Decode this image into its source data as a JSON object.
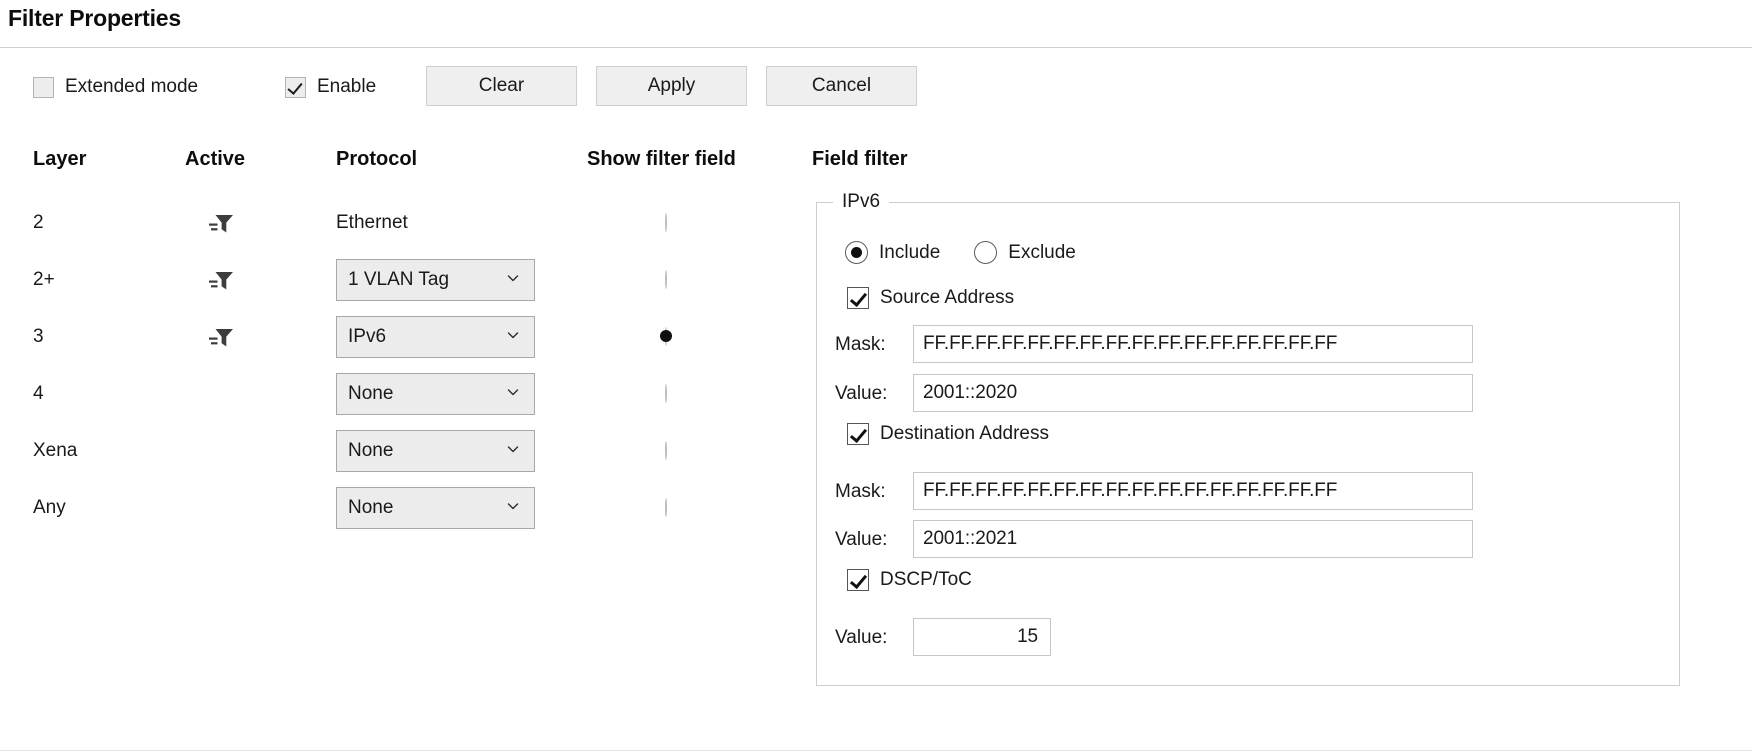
{
  "page": {
    "title": "Filter Properties"
  },
  "toolbar": {
    "extended_mode_label": "Extended mode",
    "extended_mode_checked": false,
    "enable_label": "Enable",
    "enable_checked": true,
    "clear_label": "Clear",
    "apply_label": "Apply",
    "cancel_label": "Cancel"
  },
  "columns": {
    "layer": "Layer",
    "active": "Active",
    "protocol": "Protocol",
    "show_filter_field": "Show filter field",
    "field_filter": "Field filter"
  },
  "rows": [
    {
      "layer": "2",
      "active_icon": "filter-funnel-icon",
      "active": true,
      "protocol_kind": "static",
      "protocol": "Ethernet",
      "show_filter_field": false
    },
    {
      "layer": "2+",
      "active_icon": "filter-funnel-icon",
      "active": true,
      "protocol_kind": "dropdown",
      "protocol": "1 VLAN Tag",
      "show_filter_field": false
    },
    {
      "layer": "3",
      "active_icon": "filter-funnel-icon",
      "active": true,
      "protocol_kind": "dropdown",
      "protocol": "IPv6",
      "show_filter_field": true
    },
    {
      "layer": "4",
      "active_icon": "",
      "active": false,
      "protocol_kind": "dropdown",
      "protocol": "None",
      "show_filter_field": false
    },
    {
      "layer": "Xena",
      "active_icon": "",
      "active": false,
      "protocol_kind": "dropdown",
      "protocol": "None",
      "show_filter_field": false
    },
    {
      "layer": "Any",
      "active_icon": "",
      "active": false,
      "protocol_kind": "dropdown",
      "protocol": "None",
      "show_filter_field": false
    }
  ],
  "field_filter": {
    "legend": "IPv6",
    "mode": {
      "include_label": "Include",
      "exclude_label": "Exclude",
      "selected": "Include"
    },
    "source_address": {
      "label": "Source Address",
      "checked": true,
      "mask_label": "Mask:",
      "mask_value": "FF.FF.FF.FF.FF.FF.FF.FF.FF.FF.FF.FF.FF.FF.FF.FF",
      "value_label": "Value:",
      "value": "2001::2020"
    },
    "destination_address": {
      "label": "Destination Address",
      "checked": true,
      "mask_label": "Mask:",
      "mask_value": "FF.FF.FF.FF.FF.FF.FF.FF.FF.FF.FF.FF.FF.FF.FF.FF",
      "value_label": "Value:",
      "value": "2001::2021"
    },
    "dscp_toc": {
      "label": "DSCP/ToC",
      "checked": true,
      "value_label": "Value:",
      "value": "15"
    }
  },
  "colors": {
    "accent_dot": "#101010",
    "button_face": "#efefef",
    "combo_face": "#ececec",
    "border": "#cdcdcd"
  }
}
